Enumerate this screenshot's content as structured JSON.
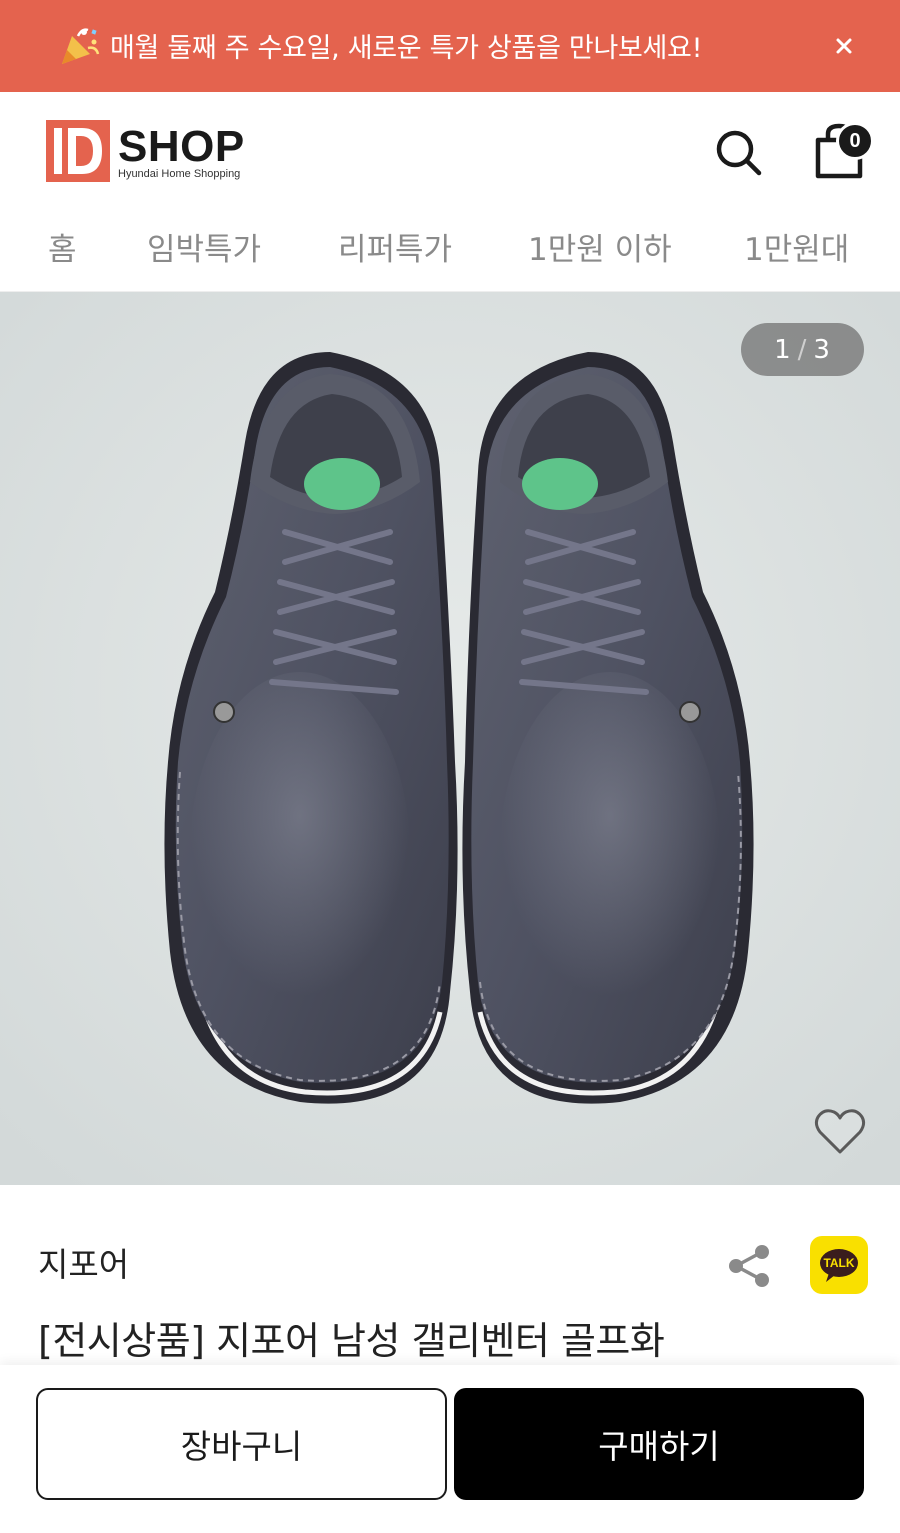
{
  "promo": {
    "text": "매월 둘째 주 수요일, 새로운 특가 상품을 만나보세요!",
    "icon": "party-popper-icon",
    "close_icon": "close-icon"
  },
  "header": {
    "logo": {
      "mark": "D",
      "name": "SHOP",
      "tagline": "Hyundai Home Shopping",
      "color": "#e4634e"
    },
    "cart_count": "0"
  },
  "nav": {
    "items": [
      "홈",
      "임박특가",
      "리퍼특가",
      "1만원 이하",
      "1만원대"
    ]
  },
  "gallery": {
    "current": "1",
    "total": "3",
    "separator": "/"
  },
  "product": {
    "brand": "지포어",
    "title": "[전시상품] 지포어 남성 갤리벤터 골프화",
    "talk_label": "TALK"
  },
  "actions": {
    "cart_label": "장바구니",
    "buy_label": "구매하기"
  },
  "colors": {
    "accent": "#e4634e",
    "primary_button": "#000000",
    "kakao": "#f9e000"
  }
}
